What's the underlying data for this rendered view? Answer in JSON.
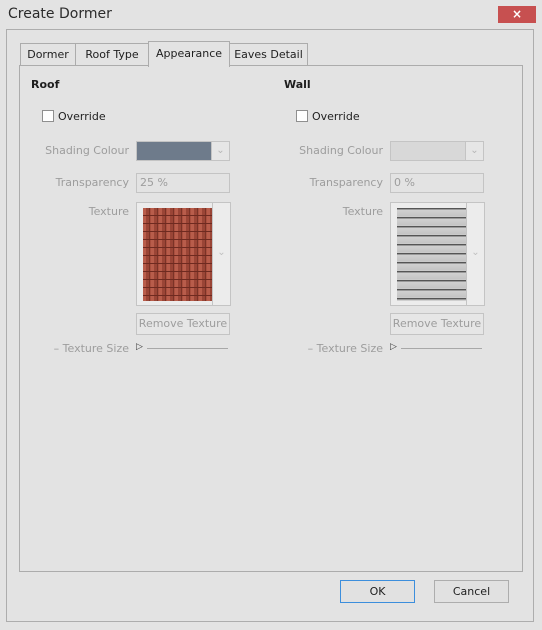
{
  "window": {
    "title": "Create Dormer",
    "close_icon": "×"
  },
  "tabs": [
    {
      "label": "Dormer",
      "active": false
    },
    {
      "label": "Roof Type",
      "active": false
    },
    {
      "label": "Appearance",
      "active": true
    },
    {
      "label": "Eaves Detail",
      "active": false
    }
  ],
  "roof": {
    "title": "Roof",
    "override_label": "Override",
    "override_checked": false,
    "shading_colour_label": "Shading Colour",
    "shading_colour_value": "#6e7b8b",
    "transparency_label": "Transparency",
    "transparency_value": "25 %",
    "texture_label": "Texture",
    "texture_name": "red-clay-roof-tiles",
    "remove_texture_label": "Remove Texture",
    "texture_size_label": "– Texture Size",
    "texture_size_value": 0
  },
  "wall": {
    "title": "Wall",
    "override_label": "Override",
    "override_checked": false,
    "shading_colour_label": "Shading Colour",
    "shading_colour_value": "#d8d8d8",
    "transparency_label": "Transparency",
    "transparency_value": "0 %",
    "texture_label": "Texture",
    "texture_name": "grey-horizontal-siding",
    "remove_texture_label": "Remove Texture",
    "texture_size_label": "– Texture Size",
    "texture_size_value": 0
  },
  "icons": {
    "dropdown": "⌄",
    "slider_thumb": "▷"
  },
  "buttons": {
    "ok": "OK",
    "cancel": "Cancel"
  }
}
